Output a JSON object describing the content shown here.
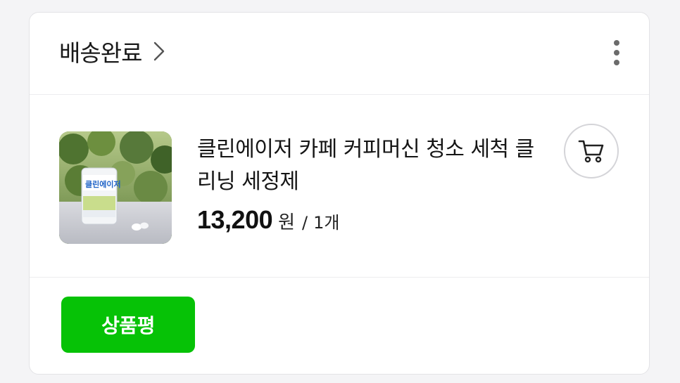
{
  "header": {
    "status_label": "배송완료",
    "status_chevron_icon": "chevron-right-icon",
    "more_icon": "more-vertical-icon"
  },
  "product": {
    "title": "클린에이저 카페 커피머신 청소 세척 클리닝 세정제",
    "price": "13,200",
    "currency_unit": "원",
    "separator": "/",
    "quantity": "1개",
    "thumbnail_label": "클린에이저",
    "cart_icon": "cart-icon"
  },
  "actions": {
    "review_button_label": "상품평"
  },
  "colors": {
    "accent_green": "#06c206",
    "text_primary": "#111111",
    "border": "#e3e3e6"
  }
}
